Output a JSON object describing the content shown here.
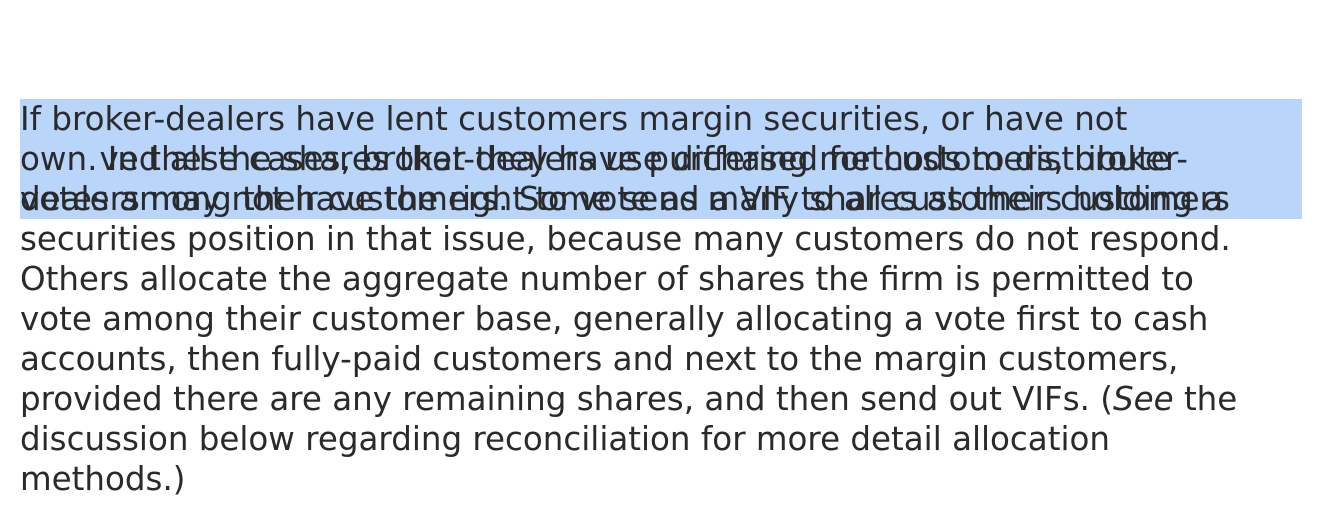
{
  "paragraph": {
    "lines": [
      "If broker-dealers have lent customers margin securities, or have not",
      "received all the shares that they have purchased for customers, broker-",
      "dealers may not have the right to vote as many shares as their customers",
      "own.",
      " In these cases, broker-dealers use differing methods to distribute",
      "votes among their customers. Some send a VIF to all customers holding a",
      "securities position in that issue, because many customers do not respond.",
      "Others allocate the aggregate number of shares the firm is permitted to",
      "vote among their customer base, generally allocating a vote first to cash",
      "accounts, then fully-paid customers and next to the margin customers,",
      "provided there are any remaining shares, and then send out VIFs. (",
      "See",
      " the",
      "discussion below regarding reconciliation for more detail allocation",
      "methods.)"
    ]
  },
  "selection": {
    "color": "#b9d5fa"
  }
}
